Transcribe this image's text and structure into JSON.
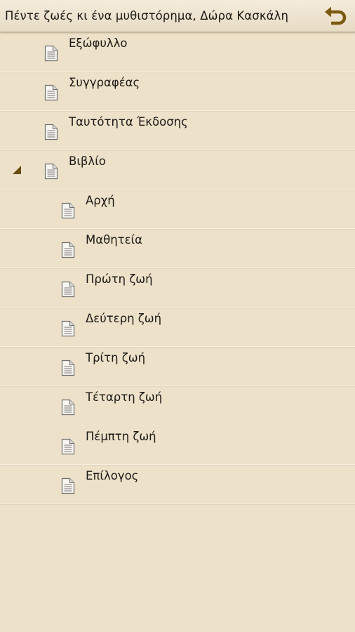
{
  "header": {
    "title": "Πέντε ζωές κι ένα μυθιστόρημα, Δώρα Κασκάλη",
    "back_icon": "undo-back-icon",
    "accent_color": "#7a5a0e"
  },
  "toc": {
    "items": [
      {
        "label": "Εξώφυλλο",
        "level": 0
      },
      {
        "label": "Συγγραφέας",
        "level": 0
      },
      {
        "label": "Ταυτότητα Έκδοσης",
        "level": 0
      },
      {
        "label": "Βιβλίο",
        "level": 0,
        "expanded": true
      },
      {
        "label": "Αρχή",
        "level": 1
      },
      {
        "label": "Μαθητεία",
        "level": 1
      },
      {
        "label": "Πρώτη ζωή",
        "level": 1
      },
      {
        "label": "Δεύτερη ζωή",
        "level": 1
      },
      {
        "label": "Τρίτη ζωή",
        "level": 1
      },
      {
        "label": "Τέταρτη ζωή",
        "level": 1
      },
      {
        "label": "Πέμπτη ζωή",
        "level": 1
      },
      {
        "label": "Επίλογος",
        "level": 1
      }
    ]
  }
}
